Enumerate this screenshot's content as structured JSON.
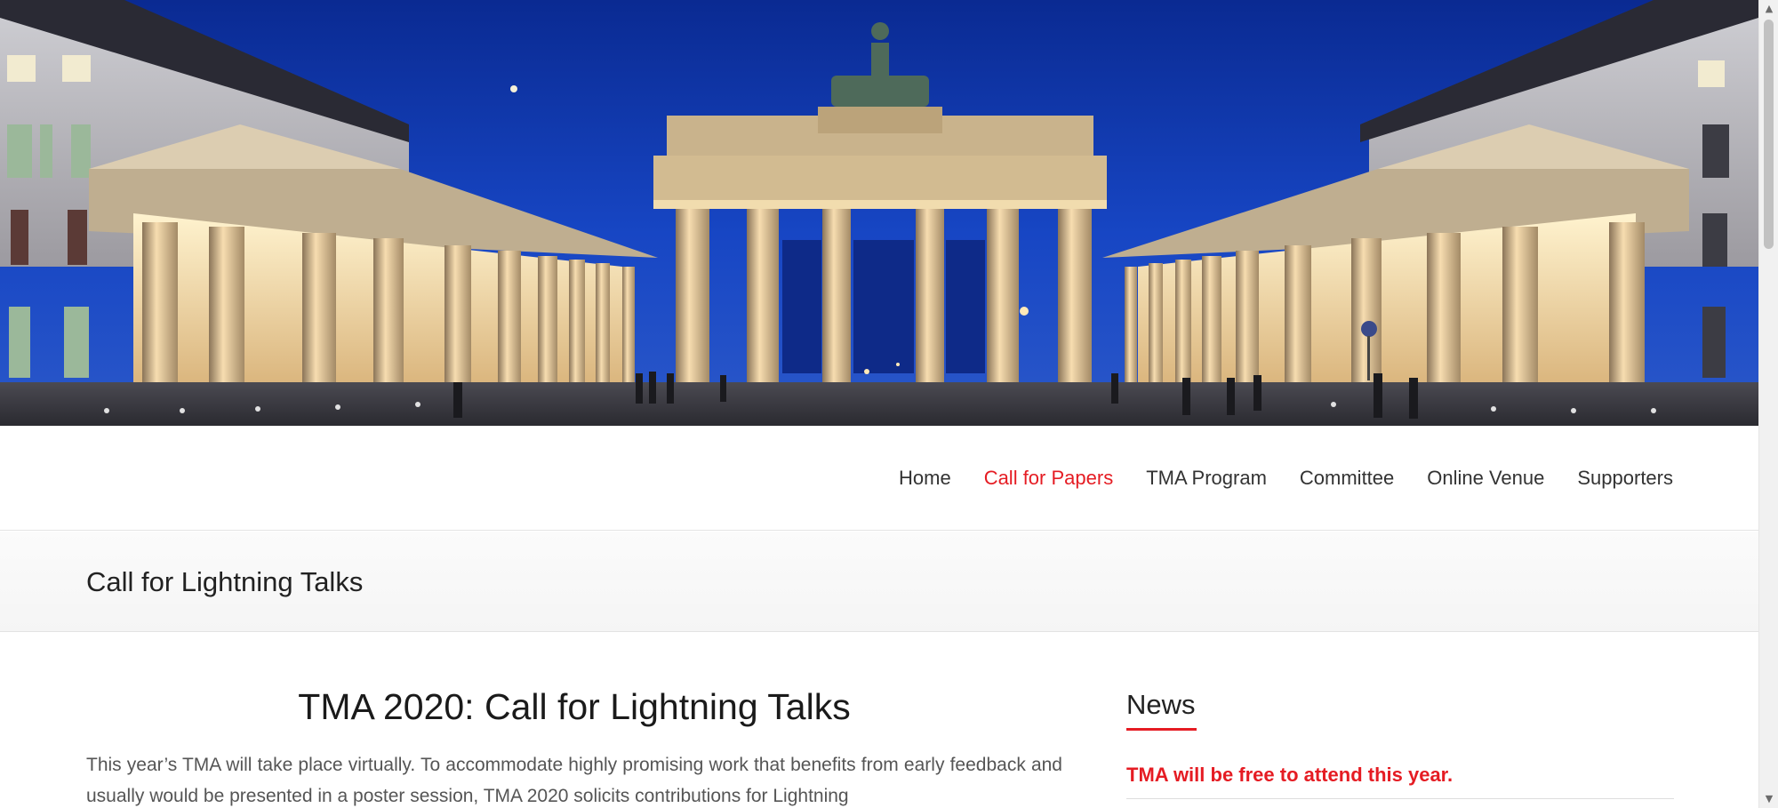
{
  "hero": {
    "image_name": "brandenburg-gate-night-photo",
    "sky_color": "#0c2e9a",
    "light_color": "#f3d29a"
  },
  "nav": {
    "items": [
      {
        "label": "Home",
        "active": false
      },
      {
        "label": "Call for Papers",
        "active": true
      },
      {
        "label": "TMA Program",
        "active": false
      },
      {
        "label": "Committee",
        "active": false
      },
      {
        "label": "Online Venue",
        "active": false
      },
      {
        "label": "Supporters",
        "active": false
      }
    ],
    "accent_color": "#e51c23"
  },
  "page": {
    "title": "Call for Lightning Talks"
  },
  "article": {
    "heading": "TMA 2020: Call for Lightning Talks",
    "body": "This year’s TMA will take place virtually. To accommodate highly promising work that benefits from early feedback and usually would be presented in a poster session, TMA 2020 solicits contributions for Lightning"
  },
  "sidebar": {
    "widget_title": "News",
    "news_items": [
      {
        "label": "TMA will be free to attend this year."
      }
    ]
  },
  "scrollbar": {
    "up_icon": "scroll-up-arrow-icon",
    "down_icon": "scroll-down-arrow-icon"
  }
}
